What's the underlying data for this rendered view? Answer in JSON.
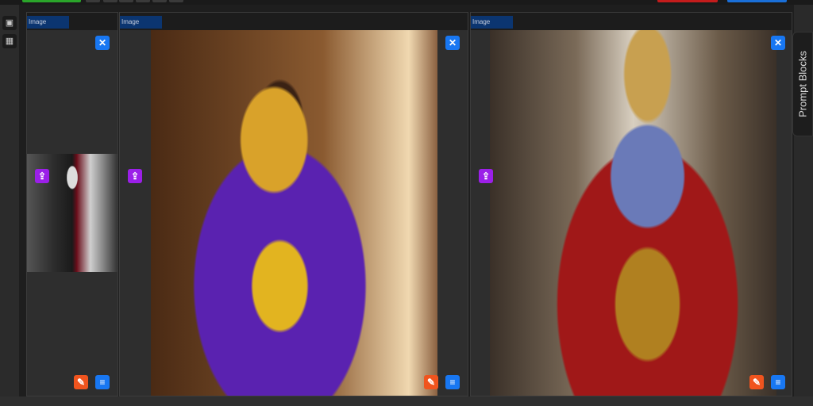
{
  "panels": [
    {
      "tab": "Image"
    },
    {
      "tab": "Image"
    },
    {
      "tab": "Image"
    }
  ],
  "sidebar": {
    "title": "Prompt Blocks"
  },
  "colors": {
    "accent": "#1877f2",
    "purple": "#9b1fe8",
    "orange": "#f0541e",
    "tab": "#0b3570"
  }
}
